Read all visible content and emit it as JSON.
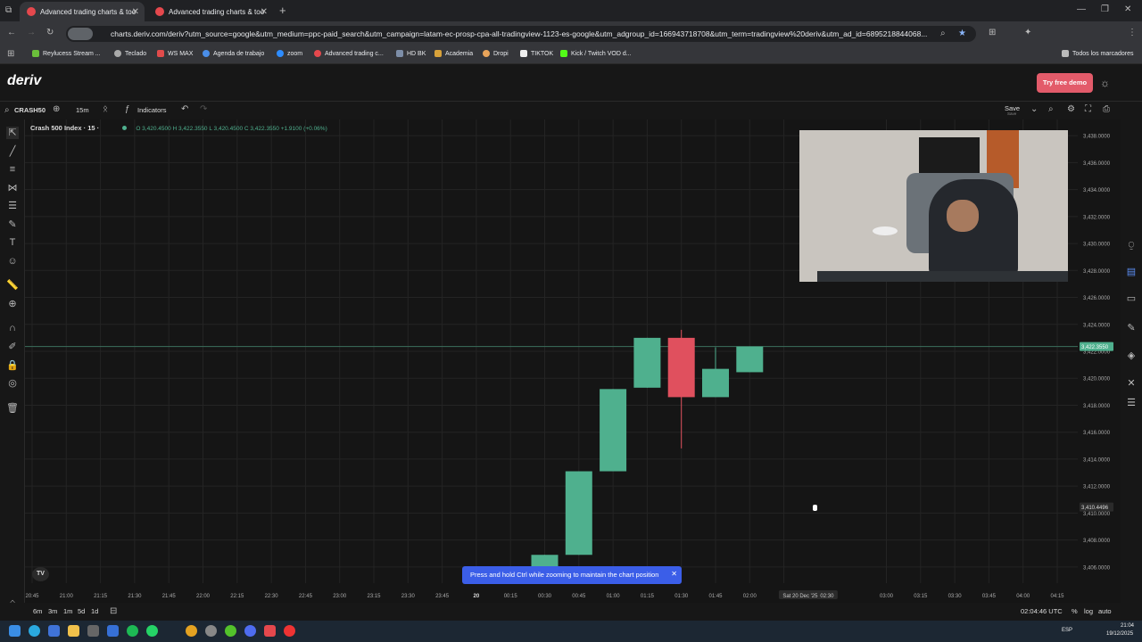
{
  "browser": {
    "tabs": [
      {
        "title": "Advanced trading charts & too",
        "active": true
      },
      {
        "title": "Advanced trading charts & too",
        "active": false
      }
    ],
    "url": "charts.deriv.com/deriv?utm_source=google&utm_medium=ppc-paid_search&utm_campaign=latam-ec-prosp-cpa-all-tradingview-1123-es-google&utm_adgroup_id=166943718708&utm_term=tradingview%20deriv&utm_ad_id=6895218844068...",
    "bookmarks": [
      "Reylucess Stream ...",
      "Teclado",
      "WS MAX",
      "Agenda de trabajo",
      "zoom",
      "Advanced trading c...",
      "HD BK",
      "Academia",
      "Dropi",
      "TIKTOK",
      "Kick / Twitch VOD d..."
    ],
    "all_bookmarks": "Todos los marcadores"
  },
  "app": {
    "logo": "deriv",
    "try_demo": "Try free demo",
    "symbol": "CRASH50",
    "interval": "15m",
    "indicators": "Indicators",
    "save": "Save",
    "save_sub": "Save"
  },
  "chart_legend": {
    "name": "Crash 500 Index · 15 ·",
    "ohlc": "O 3,420.4500  H 3,422.3550  L 3,420.4500  C 3,422.3550  +1.9100 (+0.06%)"
  },
  "chart_data": {
    "type": "candlestick",
    "y_ticks": [
      "3,438.0000",
      "3,436.0000",
      "3,434.0000",
      "3,432.0000",
      "3,430.0000",
      "3,428.0000",
      "3,426.0000",
      "3,424.0000",
      "3,422.0000",
      "3,420.0000",
      "3,418.0000",
      "3,416.0000",
      "3,414.0000",
      "3,412.0000",
      "3,410.0000",
      "3,408.0000",
      "3,406.0000"
    ],
    "ylim": [
      3404.8,
      3439.2
    ],
    "current_price": "3,422.3550",
    "crosshair_price": "3,410.4496",
    "x_ticks": [
      "20:45",
      "21:00",
      "21:15",
      "21:30",
      "21:45",
      "22:00",
      "22:15",
      "22:30",
      "22:45",
      "23:00",
      "23:15",
      "23:30",
      "23:45",
      "20",
      "00:15",
      "00:30",
      "00:45",
      "01:00",
      "01:15",
      "01:30",
      "01:45",
      "02:00",
      "02:",
      "03:45",
      "04:00",
      "04:15"
    ],
    "x_ticks_extra": [
      "03:00",
      "03:15",
      "03:30"
    ],
    "crosshair_time": "Sat 20 Dec '25",
    "crosshair_time2": "02:30",
    "candles": [
      {
        "t": "00:30",
        "o": 3405.5,
        "h": 3406.9,
        "l": 3405.5,
        "c": 3406.9
      },
      {
        "t": "00:45",
        "o": 3406.9,
        "h": 3413.1,
        "l": 3406.9,
        "c": 3413.1
      },
      {
        "t": "01:00",
        "o": 3413.1,
        "h": 3419.2,
        "l": 3413.1,
        "c": 3419.2
      },
      {
        "t": "01:15",
        "o": 3419.3,
        "h": 3423.0,
        "l": 3419.3,
        "c": 3423.0
      },
      {
        "t": "01:30",
        "o": 3423.0,
        "h": 3423.6,
        "l": 3414.8,
        "c": 3418.6
      },
      {
        "t": "01:45",
        "o": 3418.6,
        "h": 3422.3,
        "l": 3418.6,
        "c": 3420.7
      },
      {
        "t": "02:00",
        "o": 3420.45,
        "h": 3422.355,
        "l": 3420.45,
        "c": 3422.355
      }
    ],
    "colors": {
      "up": "#4fb08e",
      "down": "#e0505e",
      "grid": "#242424"
    }
  },
  "bottom": {
    "periods": [
      "6m",
      "3m",
      "1m",
      "5d",
      "1d"
    ],
    "time": "02:04:46 UTC",
    "pct": "%",
    "log": "log",
    "auto": "auto"
  },
  "toast": "Press and hold Ctrl while zooming to maintain the chart position",
  "taskbar": {
    "lang": "ESP",
    "clock": "21:04",
    "date": "19/12/2025"
  }
}
